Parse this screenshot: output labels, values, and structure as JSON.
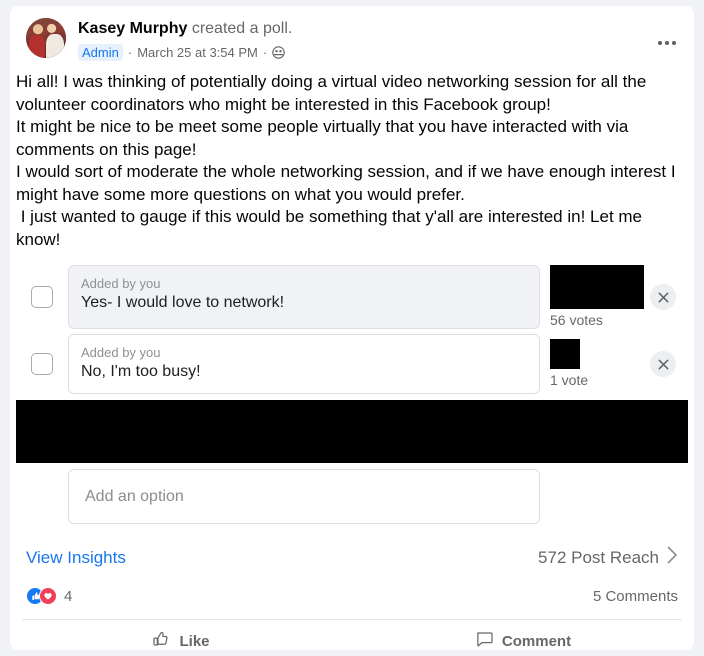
{
  "post": {
    "author": "Kasey Murphy",
    "action_text": " created a poll.",
    "admin_badge": "Admin",
    "separator": "·",
    "timestamp": "March 25 at 3:54 PM",
    "audience_icon": "group-audience-icon",
    "avatar_icon": "author-avatar",
    "more_icon": "more-options-icon",
    "body": "Hi all! I was thinking of potentially doing a virtual video networking session for all the volunteer coordinators who might be interested in this Facebook group!\nIt might be nice to be meet some people virtually that you have interacted with via comments on this page!\nI would sort of moderate the whole networking session, and if we have enough interest I might have some more questions on what you would prefer.\n I just wanted to gauge if this would be something that y'all are interested in! Let me know!"
  },
  "poll": {
    "added_by_label": "Added by you",
    "options": [
      {
        "added_by": "Added by you",
        "text": "Yes- I would love to network!",
        "votes_label": "56 votes",
        "redaction": "voter-avatars-redacted"
      },
      {
        "added_by": "Added by you",
        "text": "No, I'm too busy!",
        "votes_label": "1 vote",
        "redaction": "voter-avatars-redacted"
      }
    ],
    "redacted_bar_label": "redacted-content",
    "add_option_placeholder": "Add an option",
    "remove_icon": "close-icon"
  },
  "insights": {
    "view_insights_label": "View Insights",
    "post_reach_label": "572 Post Reach",
    "chevron_icon": "chevron-right-icon"
  },
  "engagement": {
    "reaction_count": "4",
    "comment_count": "5 Comments",
    "like_reaction_icon": "thumbs-up-reaction-icon",
    "love_reaction_icon": "heart-reaction-icon"
  },
  "actions": {
    "like_label": "Like",
    "comment_label": "Comment",
    "like_icon": "thumbs-up-outline-icon",
    "comment_icon": "comment-bubble-icon"
  },
  "colors": {
    "accent_blue": "#1877f2",
    "love_red": "#f33e58",
    "text_primary": "#050505",
    "text_secondary": "#65676b",
    "card_bg": "#ffffff",
    "page_bg": "#f0f2f5"
  }
}
